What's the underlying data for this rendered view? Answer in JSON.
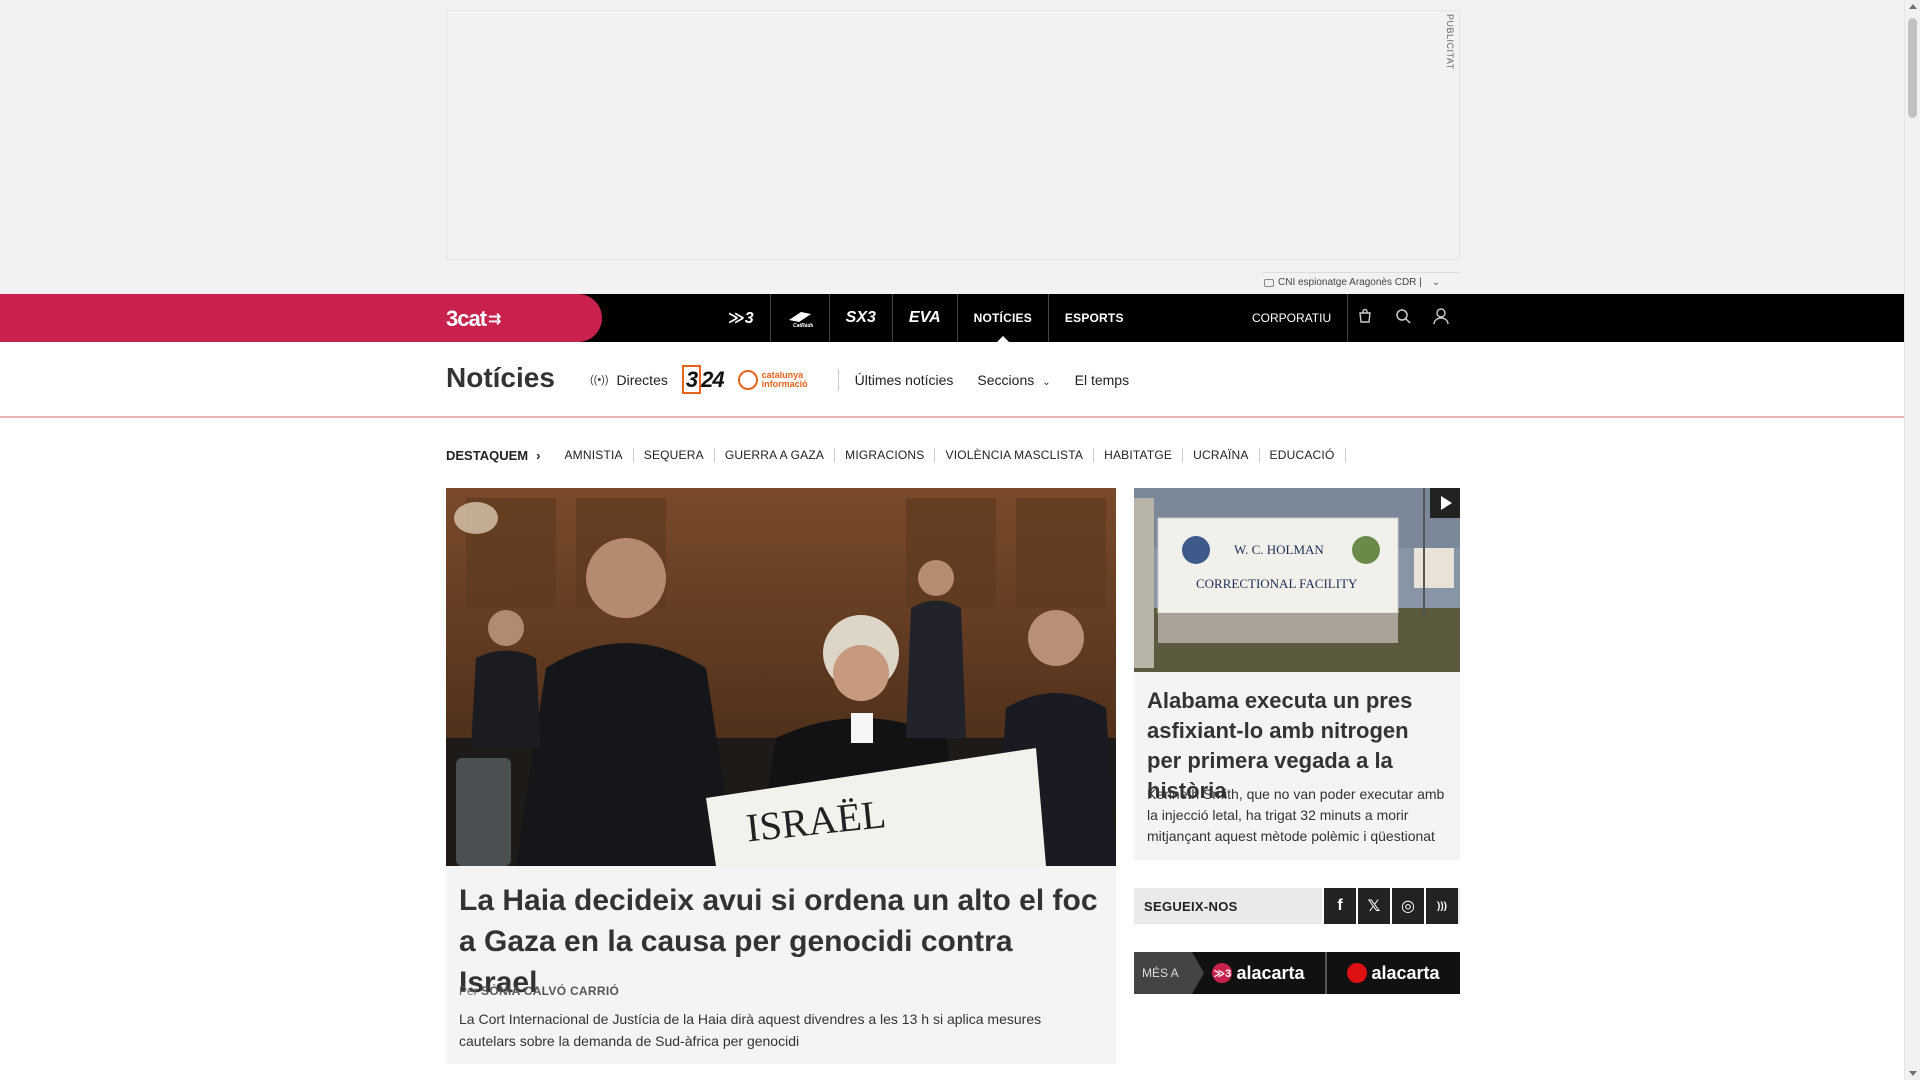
{
  "ad": {
    "label": "PUBLICITAT",
    "tag_text": "CNI espionatge Aragonès CDR |"
  },
  "topbar": {
    "logo": "3cat",
    "channels": [
      {
        "label": "3",
        "kind": "icon",
        "icon": "tv3-logo-icon"
      },
      {
        "label": "Cat Ràdio",
        "kind": "icon",
        "icon": "catradio-logo-icon"
      },
      {
        "label": "SX3",
        "kind": "icon",
        "icon": "sx3-logo-icon"
      },
      {
        "label": "EVA",
        "kind": "icon",
        "icon": "eva-logo-icon"
      },
      {
        "label": "NOTÍCIES",
        "kind": "text",
        "active": true
      },
      {
        "label": "ESPORTS",
        "kind": "text"
      }
    ],
    "corporatiu": "CORPORATIU",
    "icons": [
      "cart-icon",
      "search-icon",
      "user-icon"
    ],
    "accent_color": "#c8214d"
  },
  "section": {
    "title": "Notícies",
    "directes": "Directes",
    "logo_324": "324",
    "logo_catinf": "catalunya informació",
    "links": [
      {
        "label": "Últimes notícies"
      },
      {
        "label": "Seccions",
        "dropdown": true
      },
      {
        "label": "El temps"
      }
    ]
  },
  "destaquem": {
    "lead": "DESTAQUEM",
    "tags": [
      "AMNISTIA",
      "SEQUERA",
      "GUERRA A GAZA",
      "MIGRACIONS",
      "VIOLÈNCIA MASCLISTA",
      "HABITATGE",
      "UCRAÏNA",
      "EDUCACIÓ"
    ]
  },
  "main_article": {
    "image_placard": "ISRAËL",
    "title": "La Haia decideix avui si ordena un alto el foc a Gaza en la causa per genocidi contra Israel",
    "by": "Per",
    "author": "SÒNIA CALVÓ CARRIÓ",
    "summary": "La Cort Internacional de Justícia de la Haia dirà aquest divendres a les 13 h si aplica mesures cautelars sobre la demanda de Sud-àfrica per genocidi"
  },
  "side_article": {
    "sign_line1": "W. C. HOLMAN",
    "sign_line2": "CORRECTIONAL FACILITY",
    "title": "Alabama executa un pres asfixiant-lo amb nitrogen per primera vegada a la història",
    "summary": "Kenneth Smith, que no van poder executar amb la injecció letal, ha trigat 32 minuts a morir mitjançant aquest mètode polèmic i qüestionat"
  },
  "follow": {
    "label": "SEGUEIX-NOS",
    "networks": [
      {
        "name": "facebook-icon",
        "glyph": "f"
      },
      {
        "name": "x-icon",
        "glyph": "𝕏"
      },
      {
        "name": "instagram-icon",
        "glyph": "◎"
      },
      {
        "name": "rss-icon",
        "glyph": ")))"
      }
    ]
  },
  "alacarta": {
    "mes": "MÉS A",
    "brand1": "alacarta",
    "brand2": "alacarta"
  }
}
